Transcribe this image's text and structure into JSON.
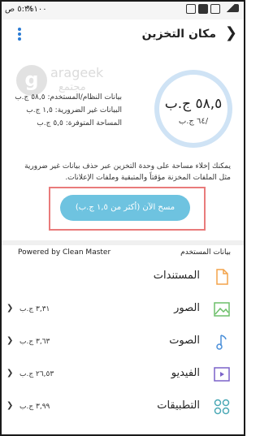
{
  "status_bar": {
    "time": "٥:٢١ ص",
    "battery": "%١٠٠"
  },
  "header": {
    "title": "مكان التخزين"
  },
  "watermark": {
    "line1": "arageek",
    "line2": "مجتمع"
  },
  "storage": {
    "used": "٥٨,٥ ج.ب",
    "total": "/٦٤ ج.ب",
    "stats": [
      "بيانات النظام/المستخدم: ٥٨,٥ ج.ب",
      "البيانات غير الضرورية: ١,٥ ج.ب",
      "المساحة المتوفرة: ٥,٥ ج.ب"
    ]
  },
  "description": "يمكنك إخلاء مساحة على وحدة التخزين عبر حذف بيانات غير ضرورية مثل الملفات المخزنة مؤقتاً والمتبقية وملفات الإعلانات.",
  "clean_button": "مسح الآن (أكثر من ١,٥ ج.ب)",
  "user_data": {
    "powered_by": "Powered by Clean Master",
    "heading": "بيانات المستخدم",
    "items": [
      {
        "label": "المستندات",
        "size": "",
        "icon": "document-icon"
      },
      {
        "label": "الصور",
        "size": "٣,٣١ ج.ب",
        "icon": "image-icon"
      },
      {
        "label": "الصوت",
        "size": "٣,٦٣ ج.ب",
        "icon": "music-note-icon"
      },
      {
        "label": "الفيديو",
        "size": "٢٦,٥٣ ج.ب",
        "icon": "video-icon"
      },
      {
        "label": "التطبيقات",
        "size": "٣,٩٩ ج.ب",
        "icon": "apps-grid-icon"
      }
    ]
  },
  "colors": {
    "accent": "#2a7bd4",
    "button": "#6ec3e0",
    "highlight": "#e97b7b",
    "icon_orange": "#f3a34a",
    "icon_green": "#6dbf6a",
    "icon_blue": "#4a8fd9",
    "icon_purple": "#7b62c9",
    "icon_teal": "#4aa8b5"
  }
}
